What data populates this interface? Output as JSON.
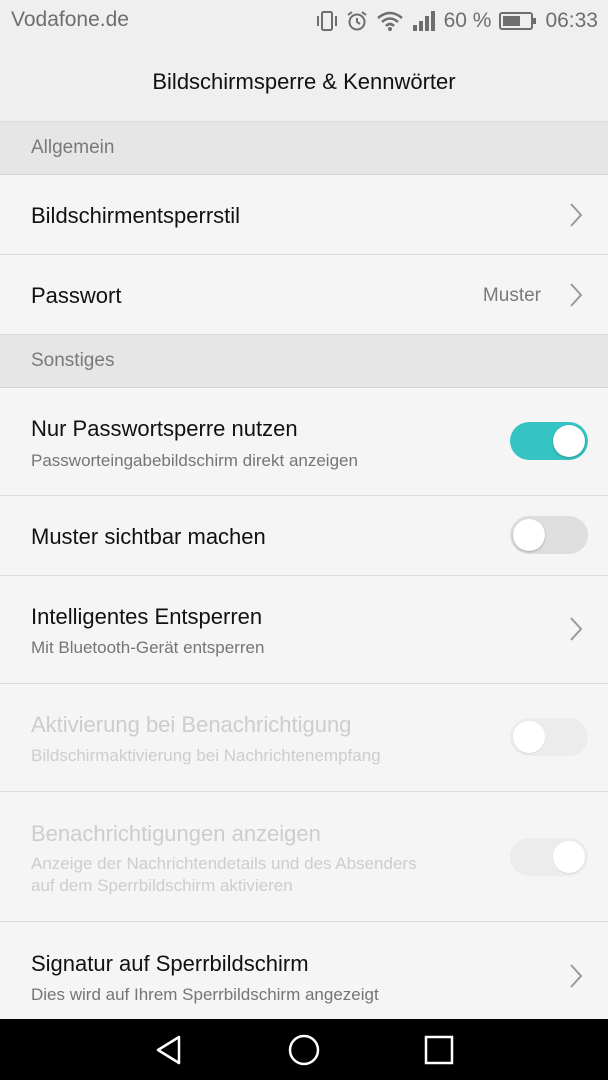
{
  "status_bar": {
    "carrier": "Vodafone.de",
    "battery_percent": "60 %",
    "time": "06:33",
    "icons": [
      "vibrate-icon",
      "alarm-icon",
      "wifi-icon",
      "signal-icon",
      "battery-icon"
    ]
  },
  "header": {
    "title": "Bildschirmsperre & Kennwörter"
  },
  "sections": {
    "general": "Allgemein",
    "other": "Sonstiges"
  },
  "settings": {
    "lock_style": {
      "title": "Bildschirmentsperrstil"
    },
    "password": {
      "title": "Passwort",
      "value": "Muster"
    },
    "password_only": {
      "title": "Nur Passwortsperre nutzen",
      "subtitle": "Passworteingabebildschirm direkt anzeigen",
      "enabled": true
    },
    "show_pattern": {
      "title": "Muster sichtbar machen",
      "enabled": false
    },
    "smart_unlock": {
      "title": "Intelligentes Entsperren",
      "subtitle": "Mit Bluetooth-Gerät entsperren"
    },
    "wake_on_notification": {
      "title": "Aktivierung bei Benachrichtigung",
      "subtitle": "Bildschirmaktivierung bei Nachrichtenempfang",
      "enabled": false,
      "disabled": true
    },
    "show_notifications": {
      "title": "Benachrichtigungen anzeigen",
      "subtitle_line1": "Anzeige der Nachrichtendetails und des Absenders",
      "subtitle_line2": "auf dem Sperrbildschirm aktivieren",
      "enabled": true,
      "disabled": true
    },
    "signature": {
      "title": "Signatur auf Sperrbildschirm",
      "subtitle": "Dies wird auf Ihrem Sperrbildschirm angezeigt"
    }
  },
  "colors": {
    "accent": "#35c3c3",
    "toggle_off": "#dedede",
    "disabled_text": "#cdcdcd"
  },
  "nav_bar": {
    "icons": [
      "back-icon",
      "home-icon",
      "recents-icon"
    ]
  }
}
